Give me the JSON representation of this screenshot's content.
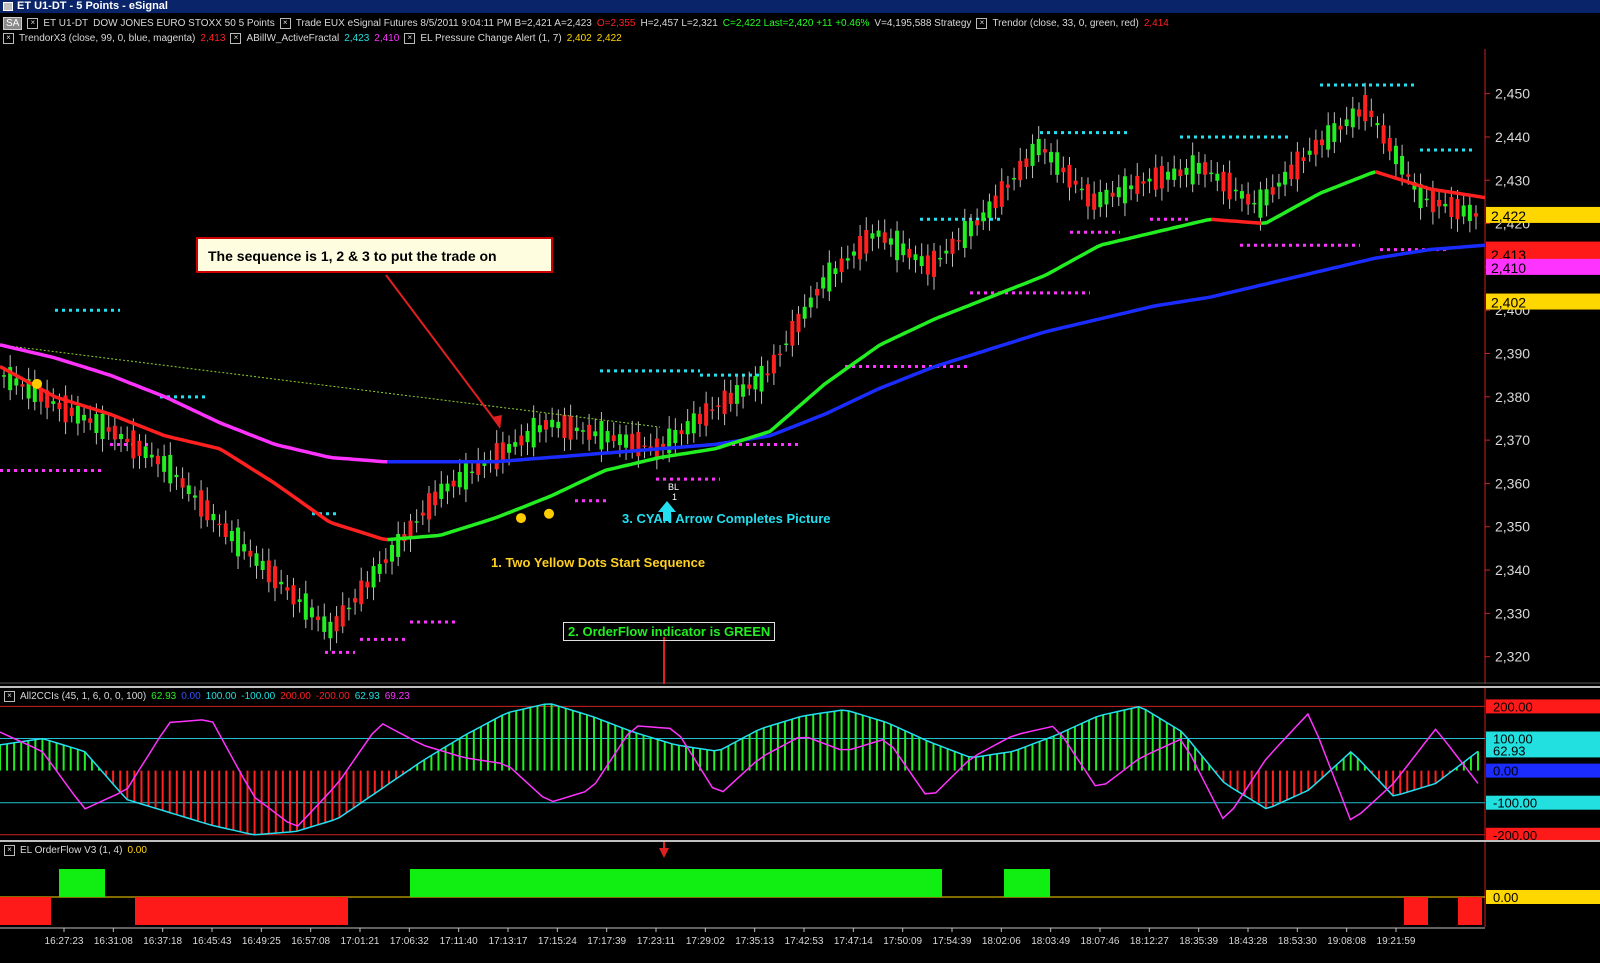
{
  "window": {
    "title": "ET U1-DT - 5 Points - eSignal"
  },
  "header": {
    "row1": [
      {
        "text": "SA",
        "kind": "badge",
        "color": "#ffffff"
      },
      {
        "text": "ET U1-DT",
        "color": "#d8d8d8"
      },
      {
        "text": "DOW JONES EURO STOXX 50  5 Points",
        "color": "#d8d8d8"
      },
      {
        "text": "Trade  EUX  eSignal  Futures  8/5/2011  9:04:11 PM  B=2,421  A=2,423",
        "color": "#d8d8d8"
      },
      {
        "text": "O=2,355",
        "color": "#ff2020"
      },
      {
        "text": "H=2,457  L=2,321",
        "color": "#d8d8d8"
      },
      {
        "text": "C=2,422  Last=2,420  +11  +0.46%",
        "color": "#22ff22"
      },
      {
        "text": "V=4,195,588  Strategy",
        "color": "#d8d8d8"
      },
      {
        "text": "Trendor (close, 33, 0, green, red)",
        "color": "#d8d8d8"
      },
      {
        "text": "2,414",
        "color": "#ff2020"
      }
    ],
    "row2": [
      {
        "text": "TrendorX3 (close, 99, 0, blue, magenta)",
        "color": "#d8d8d8"
      },
      {
        "text": "2,413",
        "color": "#ff2020"
      },
      {
        "text": "ABillW_ActiveFractal",
        "color": "#d8d8d8"
      },
      {
        "text": "2,423",
        "color": "#22e0e0"
      },
      {
        "text": "2,410",
        "color": "#ff33ff"
      },
      {
        "text": "EL Pressure Change Alert  (1, 7)",
        "color": "#d8d8d8"
      },
      {
        "text": "2,402",
        "color": "#ffd700"
      },
      {
        "text": "2,422",
        "color": "#ffd700"
      }
    ]
  },
  "chart_data": [
    {
      "type": "line",
      "panel": "price",
      "x": [
        "16:27:23",
        "16:31:08",
        "16:37:18",
        "16:45:43",
        "16:49:25",
        "16:57:08",
        "17:01:21",
        "17:06:32",
        "17:11:40",
        "17:13:17",
        "17:15:24",
        "17:17:39",
        "17:23:11",
        "17:29:02",
        "17:35:13",
        "17:42:53",
        "17:47:14",
        "17:50:09",
        "17:54:39",
        "18:02:06",
        "18:03:49",
        "18:07:46",
        "18:12:27",
        "18:35:39",
        "18:43:28",
        "18:53:30",
        "19:08:08",
        "19:21:59"
      ],
      "y_ticks": [
        "2,450",
        "2,440",
        "2,430",
        "2,420",
        "2,410",
        "2,400",
        "2,390",
        "2,380",
        "2,370",
        "2,360",
        "2,350",
        "2,340",
        "2,330",
        "2,320"
      ],
      "ylim": [
        2316,
        2458
      ],
      "series": [
        {
          "name": "Trendor (close, 33, 0, green, red)",
          "color": "#ff2020",
          "color_up": "#22ee22",
          "values": [
            2387,
            2380,
            2376,
            2371,
            2368,
            2360,
            2351,
            2347,
            2348,
            2352,
            2357,
            2363,
            2366,
            2368,
            2372,
            2383,
            2392,
            2398,
            2403,
            2408,
            2415,
            2418,
            2421,
            2420,
            2427,
            2432,
            2428,
            2426
          ]
        },
        {
          "name": "TrendorX3 (close, 99, 0, blue, magenta)",
          "color": "#ff33ff",
          "color_up": "#1a2cff",
          "values": [
            2392,
            2389,
            2385,
            2380,
            2374,
            2369,
            2366,
            2365,
            2365,
            2365,
            2366,
            2367,
            2368,
            2369,
            2371,
            2376,
            2382,
            2387,
            2391,
            2395,
            2398,
            2401,
            2403,
            2406,
            2409,
            2412,
            2414,
            2415
          ]
        },
        {
          "name": "OHLC close (approx.)",
          "color": "#22ee22",
          "values": [
            2385,
            2378,
            2372,
            2364,
            2350,
            2338,
            2326,
            2342,
            2358,
            2366,
            2374,
            2371,
            2368,
            2377,
            2385,
            2406,
            2418,
            2410,
            2422,
            2438,
            2425,
            2430,
            2433,
            2424,
            2437,
            2447,
            2426,
            2422
          ]
        }
      ],
      "price_labels": [
        {
          "text": "2,422",
          "bg": "#ffd700",
          "fg": "#000000",
          "value": 2422
        },
        {
          "text": "2,414",
          "bg": "#ff1a1a",
          "fg": "#000000",
          "value": 2414
        },
        {
          "text": "2,413",
          "bg": "#ff1a1a",
          "fg": "#000000",
          "value": 2413
        },
        {
          "text": "2,410",
          "bg": "#ff33ff",
          "fg": "#000000",
          "value": 2410
        },
        {
          "text": "2,402",
          "bg": "#ffd700",
          "fg": "#000000",
          "value": 2402
        }
      ],
      "annotations": {
        "callout": "The sequence is 1, 2 & 3 to put the trade on",
        "step1": "1. Two Yellow Dots Start Sequence",
        "step2": "2.  OrderFlow indicator is GREEN",
        "step3": "3.  CYAN Arrow Completes Picture",
        "arrow_tag": "BL",
        "arrow_tag_sub": "1"
      }
    },
    {
      "type": "line",
      "panel": "cci",
      "legend": [
        {
          "text": "All2CCIs  (45, 1, 6, 0, 0, 100)",
          "color": "#d8d8d8"
        },
        {
          "text": "62.93",
          "color": "#22ee22"
        },
        {
          "text": "0.00",
          "color": "#3355ff"
        },
        {
          "text": "100.00",
          "color": "#22e0e0"
        },
        {
          "text": "-100.00",
          "color": "#22e0e0"
        },
        {
          "text": "200.00",
          "color": "#ff2020"
        },
        {
          "text": "-200.00",
          "color": "#ff2020"
        },
        {
          "text": "62.93",
          "color": "#22e0e0"
        },
        {
          "text": "69.23",
          "color": "#ff33ff"
        }
      ],
      "levels": [
        {
          "text": "200.00",
          "value": 200,
          "bg": "#ff1a1a",
          "fg": "#000000"
        },
        {
          "text": "100.00",
          "value": 100,
          "bg": "#22e0e0",
          "fg": "#000000"
        },
        {
          "text": "62.93",
          "value": 62.93,
          "bg": "#22e0e0",
          "fg": "#000000"
        },
        {
          "text": "0.00",
          "value": 0,
          "bg": "#1a2cff",
          "fg": "#000000"
        },
        {
          "text": "-100.00",
          "value": -100,
          "bg": "#22e0e0",
          "fg": "#000000"
        },
        {
          "text": "-200.00",
          "value": -200,
          "bg": "#ff1a1a",
          "fg": "#000000"
        }
      ],
      "ylim": [
        -210,
        220
      ],
      "cci_values": [
        80,
        100,
        60,
        -90,
        -130,
        -170,
        -200,
        -190,
        -150,
        -60,
        30,
        110,
        180,
        210,
        170,
        120,
        80,
        60,
        130,
        170,
        190,
        150,
        90,
        40,
        60,
        110,
        170,
        200,
        120,
        -40,
        -120,
        -60,
        60,
        -80,
        -40,
        60
      ],
      "cci2_values": [
        120,
        60,
        -120,
        -60,
        150,
        160,
        -80,
        -180,
        -40,
        150,
        80,
        40,
        20,
        -100,
        -60,
        140,
        130,
        -80,
        40,
        110,
        60,
        100,
        -90,
        40,
        110,
        140,
        -60,
        40,
        100,
        -160,
        40,
        180,
        -160,
        -40,
        130,
        -40
      ]
    },
    {
      "type": "bar",
      "panel": "orderflow",
      "legend": [
        {
          "text": "EL OrderFlow V3  (1, 4)",
          "color": "#d8d8d8"
        },
        {
          "text": "0.00",
          "color": "#ffd700"
        }
      ],
      "zero_label": {
        "text": "0.00",
        "bg": "#ffd700",
        "fg": "#000000"
      },
      "blocks": [
        {
          "sign": -1,
          "start_index": 0,
          "end_index": 1
        },
        {
          "sign": 1,
          "start_index": 2,
          "end_index": 3
        },
        {
          "sign": -1,
          "start_index": 5,
          "end_index": 12
        },
        {
          "sign": 1,
          "start_index": 15,
          "end_index": 34
        },
        {
          "sign": 1,
          "start_index": 37,
          "end_index": 38
        },
        {
          "sign": -1,
          "start_index": 52,
          "end_index": 52
        },
        {
          "sign": -1,
          "start_index": 54,
          "end_index": 54
        }
      ]
    }
  ]
}
